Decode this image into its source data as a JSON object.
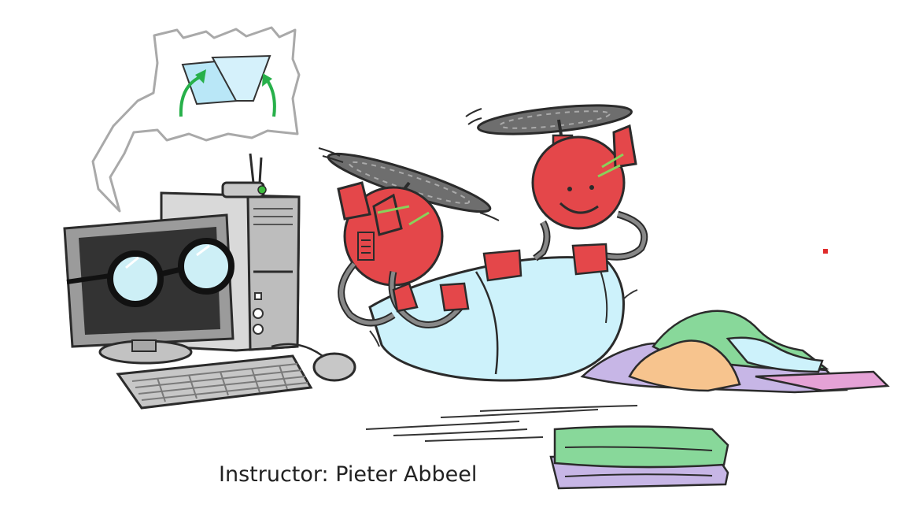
{
  "slide": {
    "instructor_caption": "Instructor: Pieter Abbeel"
  },
  "illustration": {
    "subjects": [
      "computer-with-glasses",
      "thought-bubble-folding-icon",
      "helicopter-robots",
      "laundry-pile",
      "folded-towels"
    ],
    "colors": {
      "robot_red": "#e4474a",
      "cloth_blue": "#cdf2fb",
      "outline": "#2b2b2b",
      "arrow_green": "#27b04a",
      "towel_green": "#88d89a",
      "towel_purple": "#c7b6e6",
      "cloth_orange": "#f7c48e",
      "cloth_pink": "#e5a2d6"
    }
  }
}
